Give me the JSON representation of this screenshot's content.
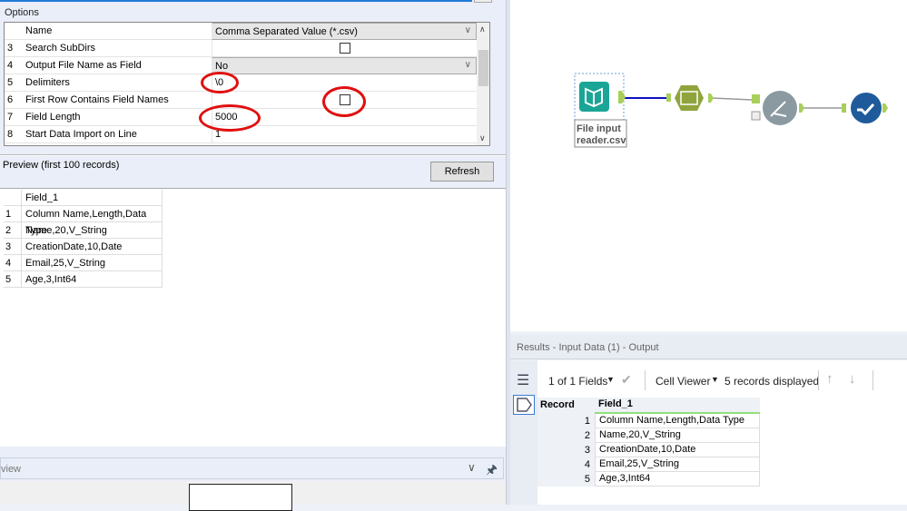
{
  "options": {
    "label": "Options",
    "header": {
      "name": "Name",
      "value": "Comma Separated Value (*.csv)"
    },
    "rows": [
      {
        "num": "3",
        "label": "Search SubDirs",
        "type": "checkbox",
        "checked": false
      },
      {
        "num": "4",
        "label": "Output File Name as Field",
        "type": "combo",
        "value": "No"
      },
      {
        "num": "5",
        "label": "Delimiters",
        "type": "text",
        "value": "\\0"
      },
      {
        "num": "6",
        "label": "First Row Contains Field Names",
        "type": "checkbox",
        "checked": false
      },
      {
        "num": "7",
        "label": "Field Length",
        "type": "text",
        "value": "5000"
      },
      {
        "num": "8",
        "label": "Start Data Import on Line",
        "type": "text",
        "value": "1"
      }
    ]
  },
  "preview": {
    "label": "Preview (first 100 records)",
    "refresh": "Refresh",
    "header": "Field_1",
    "rows": [
      {
        "n": "1",
        "v": "Column Name,Length,Data Type"
      },
      {
        "n": "2",
        "v": "Name,20,V_String"
      },
      {
        "n": "3",
        "v": "CreationDate,10,Date"
      },
      {
        "n": "4",
        "v": "Email,25,V_String"
      },
      {
        "n": "5",
        "v": "Age,3,Int64"
      }
    ]
  },
  "bottom": {
    "title": "view"
  },
  "canvas": {
    "input_caption_1": "File input",
    "input_caption_2": "reader.csv",
    "colors": {
      "input": "#1aa596",
      "text_to_columns": "#8fa43c",
      "dynamic": "#8a9aa0",
      "output": "#1f5b9a",
      "connector": "#a8cf5a"
    }
  },
  "results": {
    "title": "Results - Input Data (1) - Output",
    "fields": "1 of 1 Fields",
    "viewer": "Cell Viewer",
    "records": "5 records displayed",
    "col_record": "Record",
    "col_field": "Field_1",
    "rows": [
      {
        "n": "1",
        "v": "Column Name,Length,Data Type"
      },
      {
        "n": "2",
        "v": "Name,20,V_String"
      },
      {
        "n": "3",
        "v": "CreationDate,10,Date"
      },
      {
        "n": "4",
        "v": "Email,25,V_String"
      },
      {
        "n": "5",
        "v": "Age,3,Int64"
      }
    ]
  }
}
